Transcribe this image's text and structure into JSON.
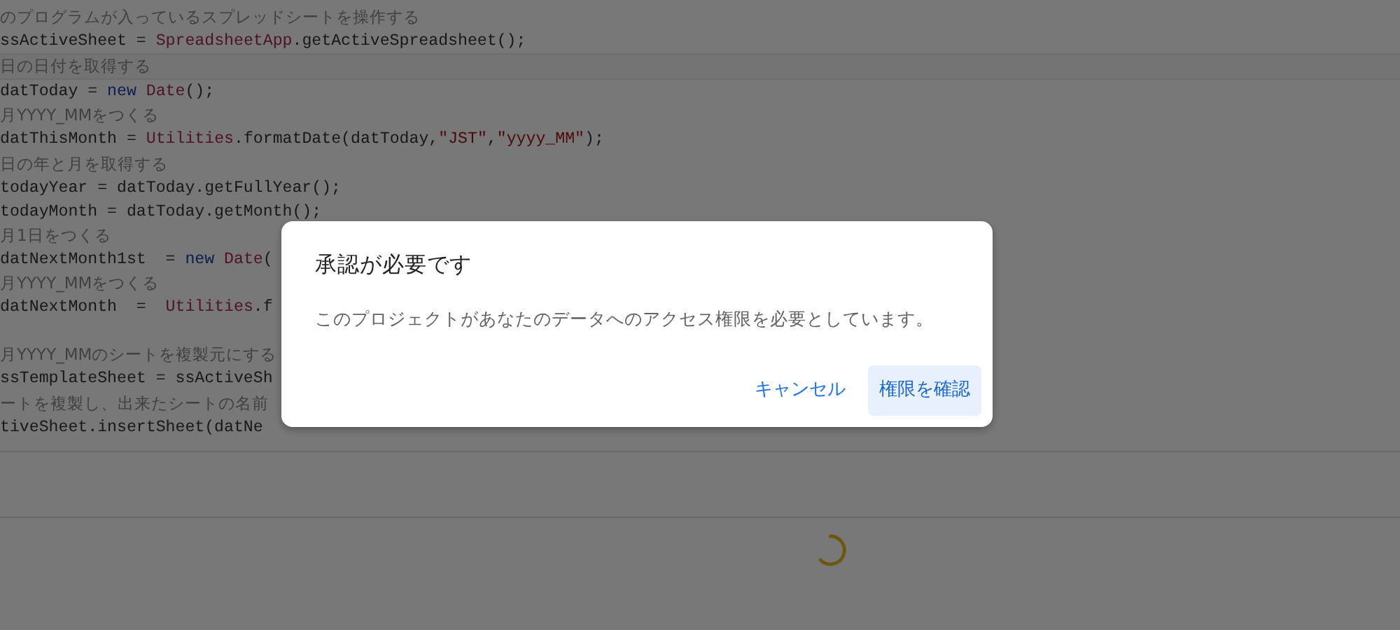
{
  "editor": {
    "lines": [
      {
        "kind": "comment",
        "text": "のプログラムが入っているスプレッドシートを操作する"
      },
      {
        "kind": "code",
        "tokens": [
          {
            "kind": "plain",
            "text": "ssActiveSheet = "
          },
          {
            "kind": "class",
            "text": "SpreadsheetApp"
          },
          {
            "kind": "plain",
            "text": ".getActiveSpreadsheet();"
          }
        ]
      },
      {
        "kind": "comment",
        "text": "日の日付を取得する"
      },
      {
        "kind": "code",
        "tokens": [
          {
            "kind": "plain",
            "text": "datToday = "
          },
          {
            "kind": "keyword",
            "text": "new"
          },
          {
            "kind": "class",
            "text": " Date"
          },
          {
            "kind": "plain",
            "text": "();"
          }
        ]
      },
      {
        "kind": "comment",
        "text": "月YYYY_MMをつくる"
      },
      {
        "kind": "code",
        "tokens": [
          {
            "kind": "plain",
            "text": "datThisMonth = "
          },
          {
            "kind": "class",
            "text": "Utilities"
          },
          {
            "kind": "plain",
            "text": ".formatDate(datToday,"
          },
          {
            "kind": "string",
            "text": "\"JST\""
          },
          {
            "kind": "plain",
            "text": ","
          },
          {
            "kind": "string",
            "text": "\"yyyy_MM\""
          },
          {
            "kind": "plain",
            "text": ");"
          }
        ]
      },
      {
        "kind": "comment",
        "text": "日の年と月を取得する"
      },
      {
        "kind": "code",
        "tokens": [
          {
            "kind": "plain",
            "text": "todayYear = datToday.getFullYear();"
          }
        ]
      },
      {
        "kind": "code",
        "tokens": [
          {
            "kind": "plain",
            "text": "todayMonth = datToday.getMonth();"
          }
        ]
      },
      {
        "kind": "comment",
        "text": "月1日をつくる"
      },
      {
        "kind": "code",
        "tokens": [
          {
            "kind": "plain",
            "text": "datNextMonth1st  = "
          },
          {
            "kind": "keyword",
            "text": "new"
          },
          {
            "kind": "class",
            "text": " Date"
          },
          {
            "kind": "plain",
            "text": "("
          }
        ]
      },
      {
        "kind": "comment",
        "text": "月YYYY_MMをつくる"
      },
      {
        "kind": "code",
        "tokens": [
          {
            "kind": "plain",
            "text": "datNextMonth  =  "
          },
          {
            "kind": "class",
            "text": "Utilities"
          },
          {
            "kind": "plain",
            "text": ".f"
          }
        ]
      },
      {
        "kind": "blank"
      },
      {
        "kind": "comment",
        "text": "月YYYY_MMのシートを複製元にする"
      },
      {
        "kind": "code",
        "tokens": [
          {
            "kind": "plain",
            "text": "ssTemplateSheet = ssActiveSh"
          }
        ]
      },
      {
        "kind": "comment",
        "text": "ートを複製し、出来たシートの名前"
      },
      {
        "kind": "code",
        "tokens": [
          {
            "kind": "plain",
            "text": "tiveSheet.insertSheet(datNe"
          }
        ]
      }
    ]
  },
  "dialog": {
    "title": "承認が必要です",
    "message": "このプロジェクトがあなたのデータへのアクセス権限を必要としています。",
    "buttons": [
      {
        "label": "キャンセル",
        "kind": "text"
      },
      {
        "label": "権限を確認",
        "kind": "tonal"
      }
    ]
  }
}
